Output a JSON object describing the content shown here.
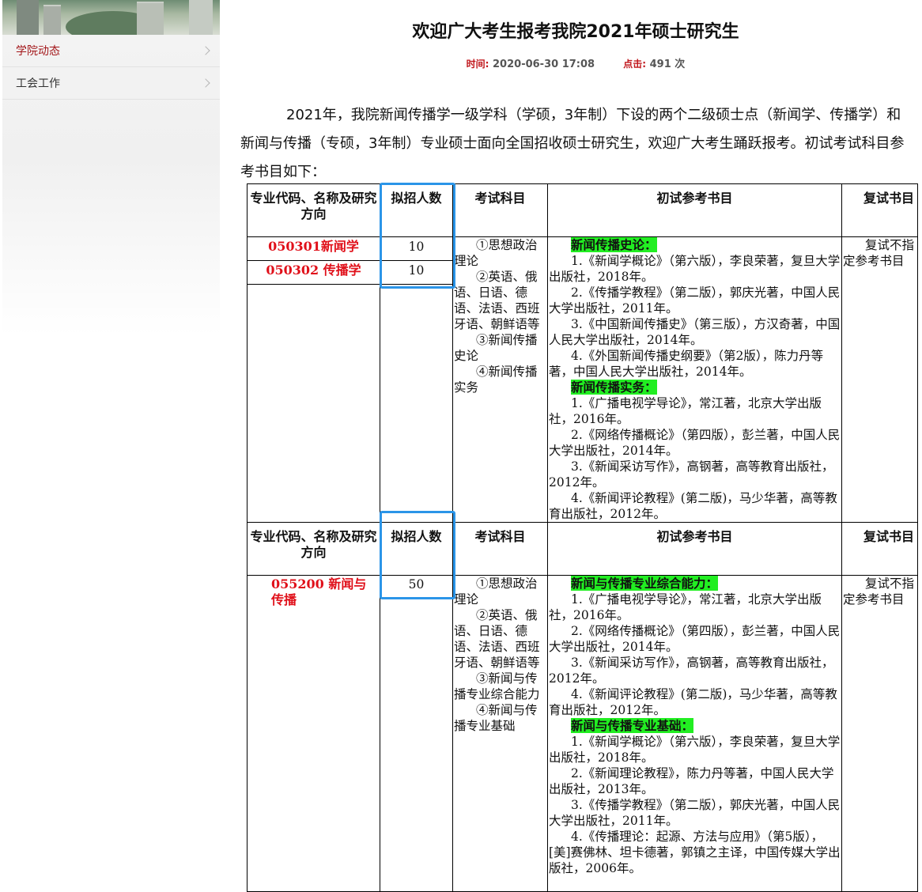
{
  "sidebar": {
    "items": [
      {
        "label": "学院动态",
        "active": true
      },
      {
        "label": "工会工作",
        "active": false
      }
    ]
  },
  "article": {
    "title": "欢迎广大考生报考我院2021年硕士研究生",
    "time_label": "时间:",
    "time_value": "2020-06-30 17:08",
    "clicks_label": "点击:",
    "clicks_value": "491 次",
    "intro": "2021年，我院新闻传播学一级学科（学硕，3年制）下设的两个二级硕士点（新闻学、传播学）和新闻与传播（专硕，3年制）专业硕士面向全国招收硕士研究生，欢迎广大考生踊跃报考。初试考试科目参考书目如下："
  },
  "table": {
    "headers": [
      "专业代码、名称及研究方向",
      "拟招人数",
      "考试科目",
      "初试参考书目",
      "复试书目"
    ],
    "group1": {
      "majors": [
        {
          "name": "050301新闻学",
          "count": "10"
        },
        {
          "name": "050302  传播学",
          "count": "10"
        }
      ],
      "subjects": [
        "①思想政治理论",
        "②英语、俄语、日语、德语、法语、西班牙语、朝鲜语等",
        "③新闻传播史论",
        "④新闻传播实务"
      ],
      "books_h1": "新闻传播史论：",
      "books1": [
        "1.《新闻学概论》（第六版），李良荣著，复旦大学出版社，2018年。",
        "2.《传播学教程》（第二版），郭庆光著，中国人民大学出版社，2011年。",
        "3.《中国新闻传播史》（第三版），方汉奇著，中国人民大学出版社，2014年。",
        "4.《外国新闻传播史纲要》（第2版），陈力丹等著，中国人民大学出版社，2014年。"
      ],
      "books_h2": "新闻传播实务：",
      "books2": [
        "1.《广播电视学导论》，常江著，北京大学出版社，2016年。",
        "2.《网络传播概论》（第四版），彭兰著，中国人民大学出版社，2014年。",
        "3.《新闻采访写作》，高钢著，高等教育出版社，2012年。",
        "4.《新闻评论教程》(第二版)，马少华著，高等教育出版社，2012年。"
      ],
      "retest": "复试不指定参考书目"
    },
    "group2": {
      "major": "055200  新闻与传播",
      "count": "50",
      "subjects": [
        "①思想政治理论",
        "②英语、俄语、日语、德语、法语、西班牙语、朝鲜语等",
        "③新闻与传播专业综合能力",
        "④新闻与传播专业基础"
      ],
      "books_h1": "新闻与传播专业综合能力：",
      "books1": [
        "1.《广播电视学导论》，常江著，北京大学出版社，2016年。",
        "2.《网络传播概论》（第四版），彭兰著，中国人民大学出版社，2014年。",
        "3.《新闻采访写作》，高钢著，高等教育出版社，2012年。",
        "4.《新闻评论教程》(第二版)，马少华著，高等教育出版社，2012年。"
      ],
      "books_h2": "新闻与传播专业基础：",
      "books2": [
        "1.《新闻学概论》（第六版），李良荣著，复旦大学出版社，2018年。",
        "2.《新闻理论教程》，陈力丹等著，中国人民大学出版社，2013年。",
        "3.《传播学教程》（第二版），郭庆光著，中国人民大学出版社，2011年。",
        "4.《传播理论：起源、方法与应用》（第5版），[美]赛佛林、坦卡德著，郭镇之主译，中国传媒大学出版社，2006年。"
      ],
      "retest": "复试不指定参考书目"
    }
  },
  "colors": {
    "accent_red": "#c0161b",
    "highlight_green": "#22ee22",
    "annotation_blue": "#2b95e8"
  }
}
